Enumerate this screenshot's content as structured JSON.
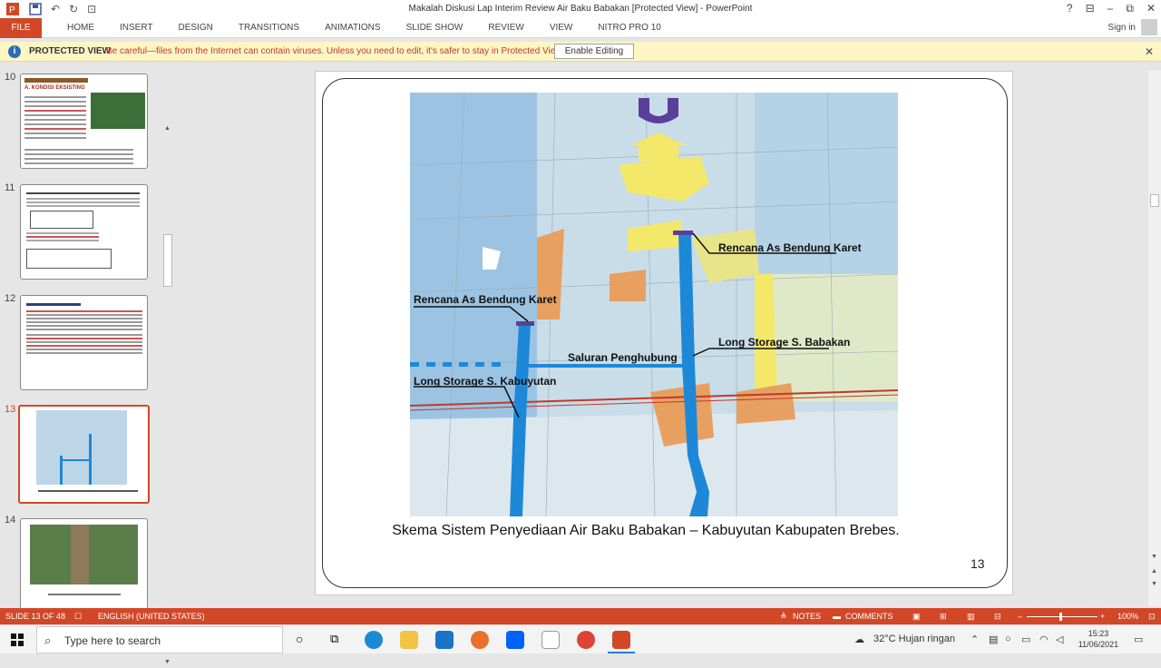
{
  "window": {
    "title": "Makalah Diskusi Lap Interim Review Air Baku Babakan [Protected View] - PowerPoint",
    "help": "?",
    "minimize": "–",
    "restore": "⧉",
    "close": "✕"
  },
  "ribbon": {
    "file": "FILE",
    "tabs": [
      "HOME",
      "INSERT",
      "DESIGN",
      "TRANSITIONS",
      "ANIMATIONS",
      "SLIDE SHOW",
      "REVIEW",
      "VIEW",
      "NITRO PRO 10"
    ],
    "signin": "Sign in"
  },
  "protected_view": {
    "label": "PROTECTED VIEW",
    "message": "Be careful—files from the Internet can contain viruses. Unless you need to edit, it's safer to stay in Protected View.",
    "button": "Enable Editing"
  },
  "thumbnails": [
    {
      "num": "10",
      "title": "A. KONDISI EKSISTING"
    },
    {
      "num": "11",
      "title": ""
    },
    {
      "num": "12",
      "title": ""
    },
    {
      "num": "13",
      "title": ""
    },
    {
      "num": "14",
      "title": ""
    }
  ],
  "slide": {
    "labels": {
      "bendung_right": "Rencana As Bendung Karet",
      "bendung_left": "Rencana As Bendung Karet",
      "long_storage_babakan": "Long Storage S. Babakan",
      "saluran": "Saluran Penghubung",
      "long_storage_kabuyutan": "Long Storage S. Kabuyutan"
    },
    "caption": "Skema Sistem Penyediaan Air Baku Babakan – Kabuyutan Kabupaten Brebes.",
    "number": "13"
  },
  "statusbar": {
    "slide": "SLIDE 13 OF 48",
    "language": "ENGLISH (UNITED STATES)",
    "notes": "NOTES",
    "comments": "COMMENTS",
    "zoom": "100%"
  },
  "taskbar": {
    "search_placeholder": "Type here to search",
    "weather": "32°C  Hujan ringan",
    "time": "15:23",
    "date": "11/06/2021"
  }
}
